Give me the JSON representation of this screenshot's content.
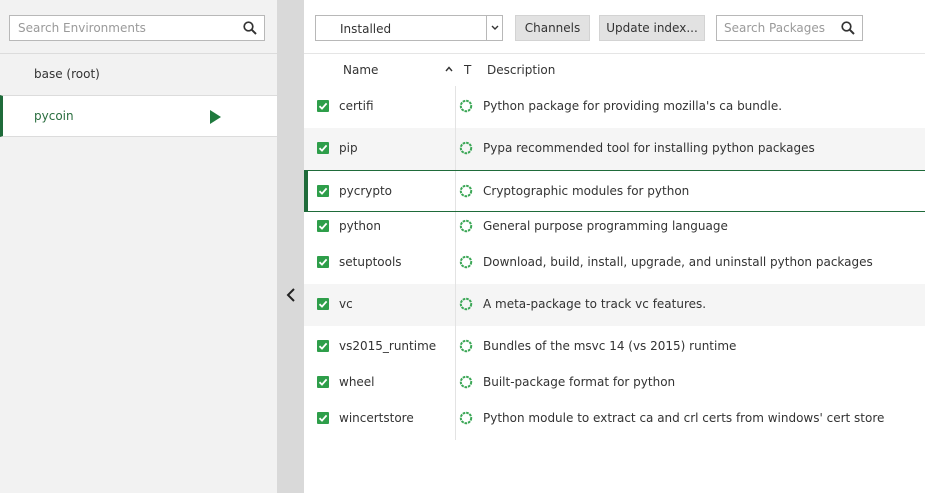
{
  "environments": {
    "search_placeholder": "Search Environments",
    "items": [
      {
        "name": "base (root)",
        "active": false
      },
      {
        "name": "pycoin",
        "active": true
      }
    ]
  },
  "toolbar": {
    "filter_value": "Installed",
    "channels_label": "Channels",
    "update_label": "Update index...",
    "search_placeholder": "Search Packages"
  },
  "table": {
    "headers": {
      "name": "Name",
      "type": "T",
      "description": "Description"
    },
    "rows": [
      {
        "name": "certifi",
        "description": "Python package for providing mozilla's ca bundle.",
        "checked": true
      },
      {
        "name": "pip",
        "description": "Pypa recommended tool for installing python packages",
        "checked": true
      },
      {
        "name": "pycrypto",
        "description": "Cryptographic modules for python",
        "checked": true
      },
      {
        "name": "python",
        "description": "General purpose programming language",
        "checked": true
      },
      {
        "name": "setuptools",
        "description": "Download, build, install, upgrade, and uninstall python packages",
        "checked": true
      },
      {
        "name": "vc",
        "description": "A meta-package to track vc features.",
        "checked": true
      },
      {
        "name": "vs2015_runtime",
        "description": "Bundles of the msvc 14 (vs 2015) runtime",
        "checked": true
      },
      {
        "name": "wheel",
        "description": "Built-package format for python",
        "checked": true
      },
      {
        "name": "wincertstore",
        "description": "Python module to extract ca and crl certs from windows' cert store",
        "checked": true
      }
    ]
  },
  "icons": {
    "search": "search-icon",
    "play": "play-icon",
    "collapse": "chevron-left-icon",
    "dropdown": "chevron-down-icon",
    "sort": "chevron-up-icon",
    "checkbox": "checkbox-checked-icon",
    "status": "installed-status-icon"
  },
  "colors": {
    "accent": "#1f6b3a",
    "checkbox": "#2e9e4a",
    "status": "#3aa655"
  }
}
